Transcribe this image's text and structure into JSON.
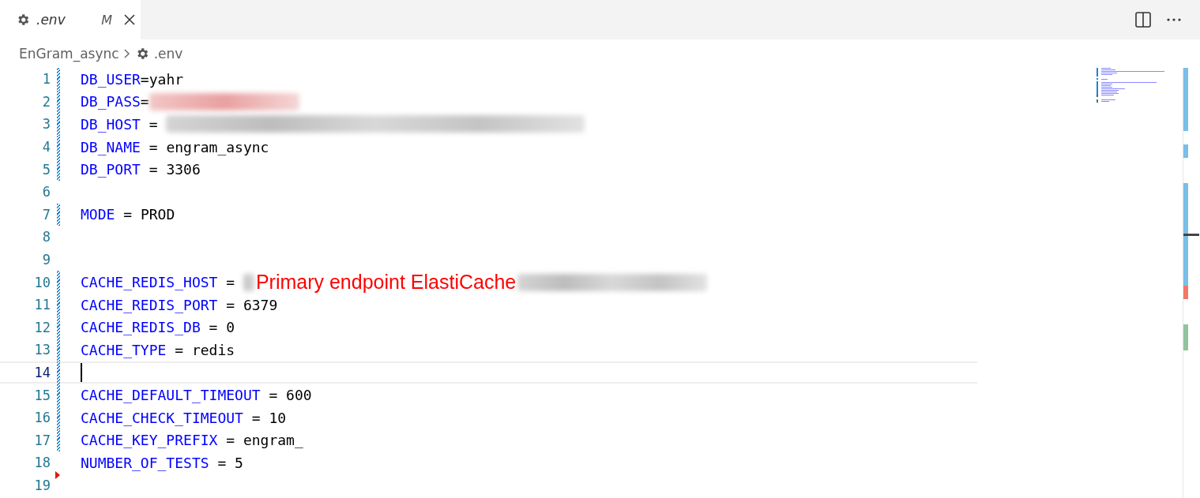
{
  "tabs": [
    {
      "label": ".env",
      "status": "M",
      "selected": true
    }
  ],
  "breadcrumb": [
    {
      "label": "EnGram_async",
      "icon": false
    },
    {
      "label": ".env",
      "icon": true
    }
  ],
  "editor": {
    "lines": [
      {
        "number": "1",
        "key": "DB_USER",
        "sep": "=",
        "value": "yahr",
        "modified": true,
        "deleted": false,
        "current": false
      },
      {
        "number": "2",
        "key": "DB_PASS",
        "sep": "=",
        "redacted": true,
        "tinted": true,
        "modified": true,
        "deleted": false,
        "current": false
      },
      {
        "number": "3",
        "key": "DB_HOST",
        "sep": " = ",
        "redacted": true,
        "tinted": false,
        "modified": true,
        "deleted": false,
        "current": false
      },
      {
        "number": "4",
        "key": "DB_NAME",
        "sep": " = ",
        "value": "engram_async",
        "modified": true,
        "deleted": false,
        "current": false
      },
      {
        "number": "5",
        "key": "DB_PORT",
        "sep": " = ",
        "value": "3306",
        "modified": true,
        "deleted": false,
        "current": false
      },
      {
        "number": "6",
        "modified": false,
        "deleted": false,
        "current": false
      },
      {
        "number": "7",
        "key": "MODE",
        "sep": " = ",
        "value": "PROD",
        "modified": true,
        "deleted": false,
        "current": false
      },
      {
        "number": "8",
        "modified": false,
        "deleted": false,
        "current": false
      },
      {
        "number": "9",
        "modified": false,
        "deleted": false,
        "current": false
      },
      {
        "number": "10",
        "key": "CACHE_REDIS_HOST",
        "sep": " = ",
        "redacted": true,
        "tinted": false,
        "annotation": "Primary endpoint ElastiCache",
        "modified": true,
        "deleted": false,
        "current": false
      },
      {
        "number": "11",
        "key": "CACHE_REDIS_PORT",
        "sep": " = ",
        "value": "6379",
        "modified": true,
        "deleted": false,
        "current": false
      },
      {
        "number": "12",
        "key": "CACHE_REDIS_DB",
        "sep": " = ",
        "value": "0",
        "modified": true,
        "deleted": false,
        "current": false
      },
      {
        "number": "13",
        "key": "CACHE_TYPE",
        "sep": " = ",
        "value": "redis",
        "modified": true,
        "deleted": false,
        "current": false
      },
      {
        "number": "14",
        "modified": true,
        "deleted": false,
        "current": true
      },
      {
        "number": "15",
        "key": "CACHE_DEFAULT_TIMEOUT",
        "sep": " = ",
        "value": "600",
        "modified": true,
        "deleted": false,
        "current": false
      },
      {
        "number": "16",
        "key": "CACHE_CHECK_TIMEOUT",
        "sep": " = ",
        "value": "10",
        "modified": true,
        "deleted": false,
        "current": false
      },
      {
        "number": "17",
        "key": "CACHE_KEY_PREFIX",
        "sep": " = ",
        "value": "engram_",
        "modified": true,
        "deleted": false,
        "current": false
      },
      {
        "number": "18",
        "key": "NUMBER_OF_TESTS",
        "sep": " = ",
        "value": "5",
        "modified": false,
        "deleted": true,
        "current": false
      },
      {
        "number": "19",
        "modified": false,
        "deleted": false,
        "current": false
      }
    ]
  }
}
